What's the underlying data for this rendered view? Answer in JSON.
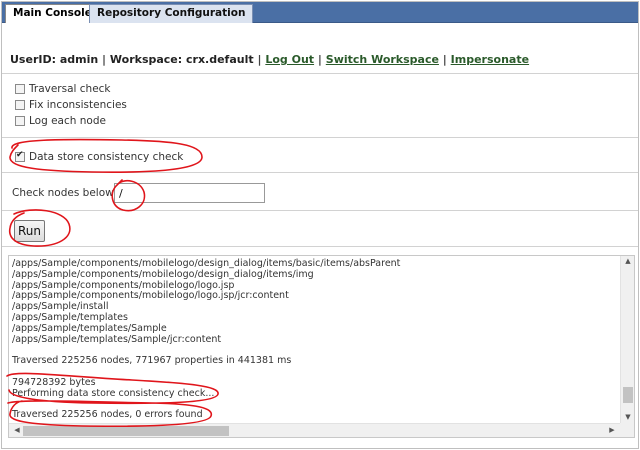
{
  "tabs": [
    {
      "label": "Main Console",
      "active": true
    },
    {
      "label": "Repository Configuration",
      "active": false
    }
  ],
  "userbar": {
    "user": "UserID: admin",
    "workspace": "Workspace: crx.default",
    "separator": "|",
    "links": [
      "Log Out",
      "Switch Workspace",
      "Impersonate"
    ]
  },
  "options": [
    {
      "label": "Traversal check",
      "checked": false
    },
    {
      "label": "Fix inconsistencies",
      "checked": false
    },
    {
      "label": "Log each node",
      "checked": false
    }
  ],
  "datastore": {
    "label": "Data store consistency check",
    "checked": true
  },
  "check_nodes": {
    "label": "Check nodes below:",
    "value": "/"
  },
  "run_label": "Run",
  "output_lines": [
    "/apps/Sample/components/mobilelogo/design_dialog/items/basic/items/absParent",
    "/apps/Sample/components/mobilelogo/design_dialog/items/img",
    "/apps/Sample/components/mobilelogo/logo.jsp",
    "/apps/Sample/components/mobilelogo/logo.jsp/jcr:content",
    "/apps/Sample/install",
    "/apps/Sample/templates",
    "/apps/Sample/templates/Sample",
    "/apps/Sample/templates/Sample/jcr:content",
    "",
    "Traversed 225256 nodes, 771967 properties in 441381 ms",
    "",
    "794728392 bytes",
    "Performing data store consistency check...",
    "",
    "Traversed 225256 nodes, 0 errors found"
  ],
  "colors": {
    "tabbar": "#4a6fa5",
    "annotation": "#e0151b",
    "link": "#2a5a2a"
  }
}
